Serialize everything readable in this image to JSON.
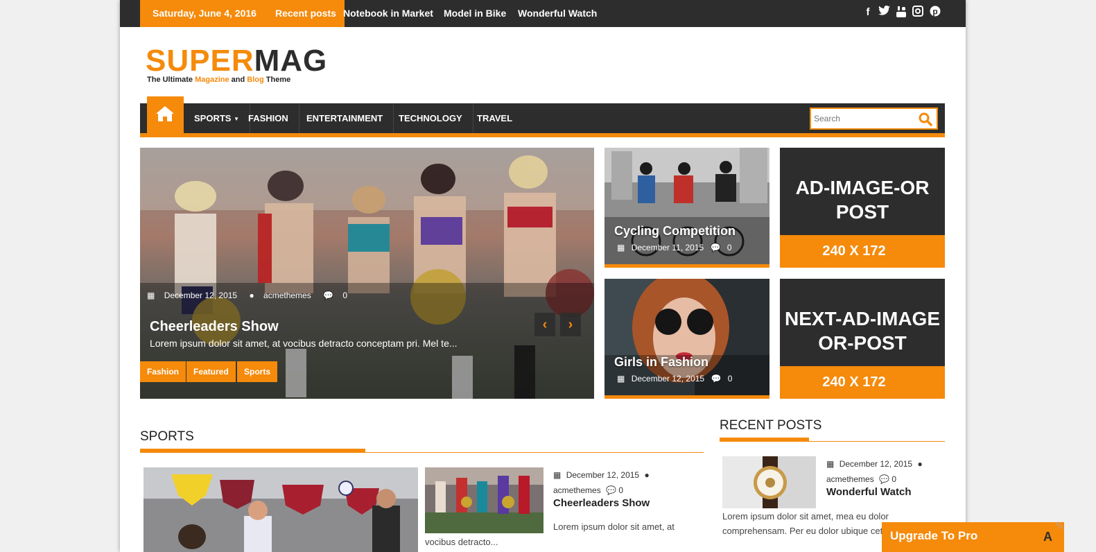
{
  "topbar": {
    "date": "Saturday, June 4, 2016",
    "recent_label": "Recent posts",
    "ticker": [
      "Notebook in Market",
      "Model in Bike",
      "Wonderful Watch"
    ],
    "social": [
      "facebook-icon",
      "twitter-icon",
      "youtube-icon",
      "instagram-icon",
      "pinterest-icon"
    ]
  },
  "logo": {
    "super": "SUPER",
    "mag": "MAG",
    "tag_a": "The Ultimate ",
    "tag_b": "Magazine",
    "tag_c": " and ",
    "tag_d": "Blog",
    "tag_e": " Theme"
  },
  "nav": {
    "items": [
      "SPORTS",
      "FASHION",
      "ENTERTAINMENT",
      "TECHNOLOGY",
      "TRAVEL"
    ],
    "search_placeholder": "Search"
  },
  "slider": {
    "date": "December 12, 2015",
    "author": "acmethemes",
    "comments": "0",
    "title": "Cheerleaders Show",
    "excerpt": "Lorem ipsum dolor sit amet, at vocibus detracto conceptam pri. Mel te...",
    "tags": [
      "Fashion",
      "Featured",
      "Sports"
    ]
  },
  "featured": [
    {
      "title": "Cycling Competition",
      "date": "December 11, 2015",
      "comments": "0"
    },
    {
      "title": "Girls in Fashion",
      "date": "December 12, 2015",
      "comments": "0"
    }
  ],
  "ads": [
    {
      "line1": "AD-IMAGE-OR",
      "line2": "POST",
      "size": "240 X 172"
    },
    {
      "line1": "NEXT-AD-IMAGE",
      "line2": "OR-POST",
      "size": "240 X 172"
    }
  ],
  "sports": {
    "heading": "SPORTS",
    "post": {
      "date": "December 12, 2015",
      "author": "acmethemes",
      "comments": "0",
      "title": "Cheerleaders Show",
      "excerpt": "Lorem ipsum dolor sit amet, at",
      "excerpt_cont": "vocibus detracto..."
    }
  },
  "recent_posts": {
    "heading": "RECENT POSTS",
    "post": {
      "date": "December 12, 2015",
      "author": "acmethemes",
      "comments": "0",
      "title": "Wonderful Watch",
      "excerpt": "Lorem ipsum dolor sit amet, mea eu dolor comprehensam. Per eu dolor ubique cetero omittam"
    }
  },
  "upgrade": {
    "label": "Upgrade To Pro"
  },
  "colors": {
    "accent": "#f58a0b",
    "dark": "#2d2d2d"
  }
}
